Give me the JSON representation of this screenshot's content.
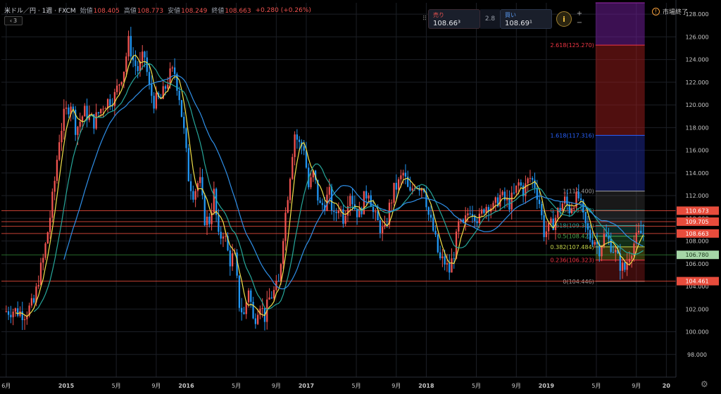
{
  "header": {
    "symbol": "米ドル／円 · 1週 · FXCM",
    "open_label": "始値",
    "open_value": "108.405",
    "high_label": "高値",
    "high_value": "108.773",
    "low_label": "安値",
    "low_value": "108.249",
    "close_label": "終値",
    "close_value": "108.663",
    "change": "+0.280 (+0.26%)",
    "collapse_count": "3"
  },
  "trade_panel": {
    "sell_label": "売り",
    "sell_price": "108.66³",
    "spread": "2.8",
    "buy_label": "買い",
    "buy_price": "108.69¹",
    "plus": "+",
    "minus": "−"
  },
  "market_status": "市場終了",
  "colors": {
    "up": "#ef5350",
    "down": "#2196f3",
    "ma_fast": "#f2e14a",
    "ma_mid": "#26a69a",
    "ma_slow": "#2f8fe8"
  },
  "chart_data": {
    "type": "candlestick",
    "y_axis": {
      "min": 96,
      "max": 129,
      "ticks": [
        "98.000",
        "100.000",
        "102.000",
        "104.000",
        "106.000",
        "108.000",
        "110.000",
        "112.000",
        "114.000",
        "116.000",
        "118.000",
        "120.000",
        "122.000",
        "124.000",
        "126.000",
        "128.000"
      ]
    },
    "x_axis": {
      "labels": [
        {
          "t": 0.0,
          "label": "6月"
        },
        {
          "t": 0.5,
          "label": "2015"
        },
        {
          "t": 0.917,
          "label": "5月"
        },
        {
          "t": 1.25,
          "label": "9月"
        },
        {
          "t": 1.5,
          "label": "2016"
        },
        {
          "t": 1.917,
          "label": "5月"
        },
        {
          "t": 2.25,
          "label": "9月"
        },
        {
          "t": 2.5,
          "label": "2017"
        },
        {
          "t": 2.917,
          "label": "5月"
        },
        {
          "t": 3.25,
          "label": "9月"
        },
        {
          "t": 3.5,
          "label": "2018"
        },
        {
          "t": 3.917,
          "label": "5月"
        },
        {
          "t": 4.25,
          "label": "9月"
        },
        {
          "t": 4.5,
          "label": "2019"
        },
        {
          "t": 4.917,
          "label": "5月"
        },
        {
          "t": 5.25,
          "label": "9月"
        },
        {
          "t": 5.5,
          "label": "20"
        }
      ],
      "range": [
        -0.04,
        5.58
      ]
    },
    "path_points": [
      [
        0.0,
        101.8
      ],
      [
        0.08,
        101.9
      ],
      [
        0.17,
        101.6
      ],
      [
        0.25,
        102.5
      ],
      [
        0.29,
        104.8
      ],
      [
        0.33,
        106.5
      ],
      [
        0.38,
        109.8
      ],
      [
        0.42,
        113.0
      ],
      [
        0.46,
        117.0
      ],
      [
        0.5,
        119.0
      ],
      [
        0.56,
        120.3
      ],
      [
        0.6,
        117.8
      ],
      [
        0.67,
        119.4
      ],
      [
        0.75,
        118.5
      ],
      [
        0.83,
        120.1
      ],
      [
        0.92,
        120.7
      ],
      [
        1.0,
        123.2
      ],
      [
        1.04,
        125.6
      ],
      [
        1.08,
        123.8
      ],
      [
        1.12,
        123.0
      ],
      [
        1.17,
        124.5
      ],
      [
        1.21,
        121.5
      ],
      [
        1.25,
        120.3
      ],
      [
        1.31,
        120.5
      ],
      [
        1.38,
        122.6
      ],
      [
        1.42,
        123.0
      ],
      [
        1.46,
        120.9
      ],
      [
        1.5,
        117.6
      ],
      [
        1.54,
        113.5
      ],
      [
        1.58,
        112.2
      ],
      [
        1.63,
        113.5
      ],
      [
        1.67,
        110.0
      ],
      [
        1.71,
        109.7
      ],
      [
        1.75,
        112.2
      ],
      [
        1.79,
        108.0
      ],
      [
        1.83,
        109.0
      ],
      [
        1.88,
        106.2
      ],
      [
        1.92,
        106.8
      ],
      [
        1.96,
        102.5
      ],
      [
        2.0,
        101.4
      ],
      [
        2.04,
        104.0
      ],
      [
        2.08,
        100.7
      ],
      [
        2.13,
        102.8
      ],
      [
        2.17,
        101.2
      ],
      [
        2.21,
        102.9
      ],
      [
        2.25,
        103.5
      ],
      [
        2.29,
        104.2
      ],
      [
        2.33,
        109.0
      ],
      [
        2.38,
        113.5
      ],
      [
        2.42,
        117.6
      ],
      [
        2.46,
        116.5
      ],
      [
        2.5,
        116.3
      ],
      [
        2.54,
        112.6
      ],
      [
        2.58,
        114.0
      ],
      [
        2.63,
        111.0
      ],
      [
        2.67,
        111.3
      ],
      [
        2.71,
        112.2
      ],
      [
        2.75,
        110.0
      ],
      [
        2.79,
        111.2
      ],
      [
        2.83,
        110.0
      ],
      [
        2.88,
        112.5
      ],
      [
        2.92,
        111.0
      ],
      [
        2.96,
        110.3
      ],
      [
        3.0,
        111.7
      ],
      [
        3.04,
        112.6
      ],
      [
        3.08,
        110.3
      ],
      [
        3.13,
        109.3
      ],
      [
        3.17,
        108.6
      ],
      [
        3.21,
        110.9
      ],
      [
        3.25,
        112.5
      ],
      [
        3.29,
        113.1
      ],
      [
        3.33,
        114.0
      ],
      [
        3.38,
        111.9
      ],
      [
        3.42,
        113.2
      ],
      [
        3.46,
        112.9
      ],
      [
        3.5,
        112.8
      ],
      [
        3.54,
        110.2
      ],
      [
        3.58,
        108.8
      ],
      [
        3.63,
        106.3
      ],
      [
        3.67,
        106.2
      ],
      [
        3.71,
        105.3
      ],
      [
        3.75,
        107.0
      ],
      [
        3.79,
        109.4
      ],
      [
        3.83,
        109.2
      ],
      [
        3.88,
        111.0
      ],
      [
        3.92,
        110.5
      ],
      [
        3.96,
        109.8
      ],
      [
        4.0,
        111.0
      ],
      [
        4.04,
        111.3
      ],
      [
        4.08,
        110.8
      ],
      [
        4.13,
        112.0
      ],
      [
        4.17,
        111.6
      ],
      [
        4.21,
        111.3
      ],
      [
        4.25,
        112.0
      ],
      [
        4.29,
        113.1
      ],
      [
        4.33,
        112.4
      ],
      [
        4.38,
        113.6
      ],
      [
        4.42,
        113.1
      ],
      [
        4.46,
        111.5
      ],
      [
        4.5,
        108.8
      ],
      [
        4.54,
        109.0
      ],
      [
        4.58,
        109.7
      ],
      [
        4.63,
        110.9
      ],
      [
        4.67,
        111.6
      ],
      [
        4.71,
        110.8
      ],
      [
        4.75,
        111.6
      ],
      [
        4.79,
        111.8
      ],
      [
        4.83,
        109.8
      ],
      [
        4.88,
        108.3
      ],
      [
        4.92,
        108.2
      ],
      [
        4.96,
        107.3
      ],
      [
        5.0,
        108.4
      ],
      [
        5.04,
        108.0
      ],
      [
        5.08,
        107.3
      ],
      [
        5.13,
        106.0
      ],
      [
        5.17,
        105.4
      ],
      [
        5.21,
        106.9
      ],
      [
        5.25,
        107.8
      ],
      [
        5.29,
        108.5
      ],
      [
        5.31,
        108.66
      ]
    ],
    "moving_averages": [
      {
        "color": "#f2e14a",
        "period": 5
      },
      {
        "color": "#26a69a",
        "period": 13
      },
      {
        "color": "#2f8fe8",
        "period": 26
      }
    ],
    "horizontal_lines": [
      {
        "price": 110.673,
        "color": "#e74c3c",
        "label": "110.673"
      },
      {
        "price": 109.705,
        "color": "#e74c3c",
        "label": "109.705"
      },
      {
        "price": 109.3,
        "color": "#e74c3c"
      },
      {
        "price": 108.663,
        "color": "#e74c3c",
        "label": "108.663"
      },
      {
        "price": 106.78,
        "color": "#2e7d32",
        "label": "106.780",
        "label_bg": "#a5d6a7"
      },
      {
        "price": 104.461,
        "color": "#e74c3c",
        "label": "104.461"
      }
    ],
    "fibonacci": {
      "t_start": 4.91,
      "t_end": 5.32,
      "levels": [
        {
          "label": "0(104.446)",
          "price": 104.446,
          "color": "#9e9e9e",
          "fill": "rgba(200,40,40,0.30)"
        },
        {
          "label": "0.236(106.323)",
          "price": 106.323,
          "color": "#f23645",
          "fill": "rgba(180,180,40,0.30)"
        },
        {
          "label": "0.382(107.484)",
          "price": 107.484,
          "color": "#c6d64a",
          "fill": "rgba(60,160,80,0.28)"
        },
        {
          "label": "0.5(108.423)",
          "price": 108.423,
          "color": "#4caf50",
          "fill": "rgba(40,150,140,0.28)"
        },
        {
          "label": "0.618(109.362)",
          "price": 109.362,
          "color": "#26a69a",
          "fill": "rgba(100,110,120,0.28)"
        },
        {
          "label": "0.786(110.698)",
          "price": 110.698,
          "color": "#26a69a",
          "fill": "rgba(90,90,90,0.28)"
        },
        {
          "label": "1(112.400)",
          "price": 112.4,
          "color": "#9e9e9e",
          "fill": "rgba(30,40,140,0.55)"
        },
        {
          "label": "1.618(117.316)",
          "price": 117.316,
          "color": "#2962ff",
          "fill": "rgba(160,30,30,0.50)"
        },
        {
          "label": "2.618(125.270)",
          "price": 125.27,
          "color": "#f23645",
          "fill": "rgba(110,30,150,0.55)"
        },
        {
          "label": "",
          "price": 129.0,
          "color": "#9c27b0",
          "fill": ""
        }
      ]
    }
  }
}
